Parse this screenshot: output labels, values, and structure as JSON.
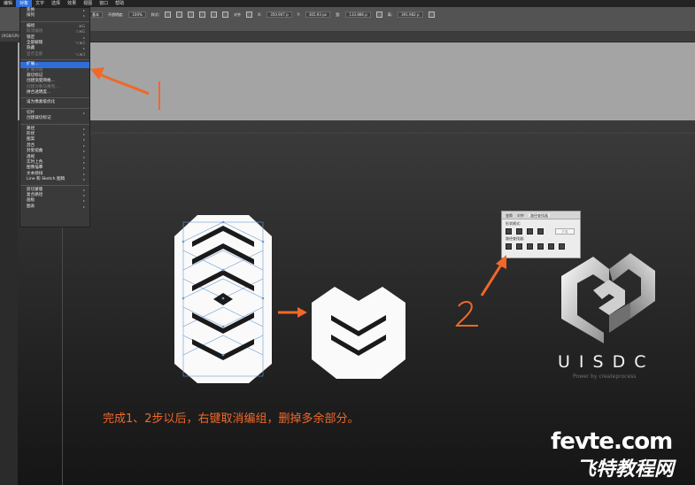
{
  "menubar": {
    "items": [
      "编辑",
      "对象",
      "文字",
      "选择",
      "效果",
      "视图",
      "窗口",
      "帮助"
    ],
    "active_index": 1
  },
  "toolbar": {
    "opacity_label": "不透明度:",
    "opacity_value": "100%",
    "style_label": "样式:",
    "basic_label": "基本",
    "align_label": "对齐",
    "x_label": "X:",
    "x_value": "350.907 p",
    "y_label": "Y:",
    "y_value": "365.93 px",
    "w_label": "宽:",
    "w_value": "133.886 p",
    "h_label": "高:",
    "h_value": "391.982 p"
  },
  "tabstrip": {
    "label": "(RGB/GPU"
  },
  "object_menu": {
    "items": [
      {
        "label": "变换",
        "shortcut": "▸",
        "disabled": false
      },
      {
        "label": "排列",
        "shortcut": "▸",
        "disabled": false
      },
      {
        "sep": true
      },
      {
        "label": "编组",
        "shortcut": "⌘G",
        "disabled": false
      },
      {
        "label": "取消编组",
        "shortcut": "⇧⌘G",
        "disabled": true
      },
      {
        "label": "锁定",
        "shortcut": "▸",
        "disabled": false
      },
      {
        "label": "全部解锁",
        "shortcut": "⌥⌘2",
        "disabled": false
      },
      {
        "label": "隐藏",
        "shortcut": "▸",
        "disabled": false
      },
      {
        "label": "显示全部",
        "shortcut": "⌥⌘3",
        "disabled": true
      },
      {
        "sep": true
      },
      {
        "label": "扩展...",
        "shortcut": "",
        "disabled": false,
        "highlight": true
      },
      {
        "label": "扩展外观",
        "shortcut": "",
        "disabled": true
      },
      {
        "label": "裁切标记",
        "shortcut": "",
        "disabled": false
      },
      {
        "label": "创建渐变网格...",
        "shortcut": "",
        "disabled": false
      },
      {
        "label": "创建对象马赛克...",
        "shortcut": "",
        "disabled": true
      },
      {
        "label": "拼合透明度...",
        "shortcut": "",
        "disabled": false
      },
      {
        "sep": true
      },
      {
        "label": "设为像素级优化",
        "shortcut": "",
        "disabled": false
      },
      {
        "sep": true
      },
      {
        "label": "切片",
        "shortcut": "▸",
        "disabled": false
      },
      {
        "label": "创建裁切标记",
        "shortcut": "",
        "disabled": false
      },
      {
        "sep": true
      },
      {
        "label": "路径",
        "shortcut": "▸",
        "disabled": false
      },
      {
        "label": "形状",
        "shortcut": "▸",
        "disabled": false
      },
      {
        "label": "图案",
        "shortcut": "▸",
        "disabled": false
      },
      {
        "label": "混合",
        "shortcut": "▸",
        "disabled": false
      },
      {
        "label": "封套扭曲",
        "shortcut": "▸",
        "disabled": false
      },
      {
        "label": "透视",
        "shortcut": "▸",
        "disabled": false
      },
      {
        "label": "实时上色",
        "shortcut": "▸",
        "disabled": false
      },
      {
        "label": "图像描摹",
        "shortcut": "▸",
        "disabled": false
      },
      {
        "label": "文本绕排",
        "shortcut": "▸",
        "disabled": false
      },
      {
        "label": "Line 和 Sketch 图稿",
        "shortcut": "▸",
        "disabled": false
      },
      {
        "sep": true
      },
      {
        "label": "剪切蒙版",
        "shortcut": "▸",
        "disabled": false
      },
      {
        "label": "复合路径",
        "shortcut": "▸",
        "disabled": false
      },
      {
        "label": "画板",
        "shortcut": "▸",
        "disabled": false
      },
      {
        "label": "图表",
        "shortcut": "▸",
        "disabled": false
      }
    ]
  },
  "pathfinder": {
    "tabs": [
      "变换",
      "对齐",
      "路径查找器"
    ],
    "active_tab": 2,
    "shape_modes_label": "形状模式:",
    "expand_label": "扩展",
    "pathfinders_label": "路径查找器:"
  },
  "annotations": {
    "step1": "1",
    "step2": "2",
    "caption": "完成1、2步以后，右键取消编组，删掉多余部分。"
  },
  "brand": {
    "name": "UISDC",
    "sub": "Power by createprocess"
  },
  "watermark": {
    "latin": "fevte.com",
    "cn": "飞特教程网"
  },
  "colors": {
    "accent_orange": "#f0682a",
    "menu_highlight": "#2f6ed8"
  }
}
